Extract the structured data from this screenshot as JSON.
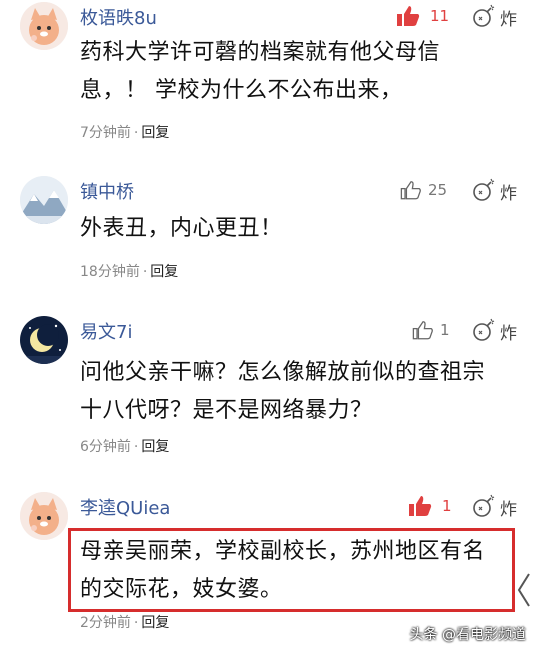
{
  "comments": [
    {
      "avatar": "cat-avatar-icon",
      "name": "枚语昳8u",
      "likes": "11",
      "liked": true,
      "content_lines": [
        "药科大学许可磬的档案就有他父母信",
        "息，！ 学校为什么不公布出来，"
      ],
      "time": "7分钟前",
      "reply": "回复",
      "bomb": "炸"
    },
    {
      "avatar": "snow-mountain-avatar-icon",
      "name": "镇中桥",
      "likes": "25",
      "liked": false,
      "content_lines": [
        "外表丑，内心更丑！"
      ],
      "time": "18分钟前",
      "reply": "回复",
      "bomb": "炸"
    },
    {
      "avatar": "moon-avatar-icon",
      "name": "易文7i",
      "likes": "1",
      "liked": false,
      "content_lines": [
        "问他父亲干嘛？怎么像解放前似的查祖宗",
        "十八代呀？是不是网络暴力？"
      ],
      "time": "6分钟前",
      "reply": "回复",
      "bomb": "炸"
    },
    {
      "avatar": "cat-avatar-icon",
      "name": "李逵QUiea",
      "likes": "1",
      "liked": true,
      "content_lines": [
        "母亲吴丽荣，学校副校长，苏州地区有名",
        "的交际花，妓女婆。"
      ],
      "time": "2分钟前",
      "reply": "回复",
      "bomb": "炸"
    }
  ],
  "watermark": "头条 @看电影频道",
  "colors": {
    "name": "#3b5998",
    "liked": "#e04040",
    "highlight": "#d62d2d"
  }
}
